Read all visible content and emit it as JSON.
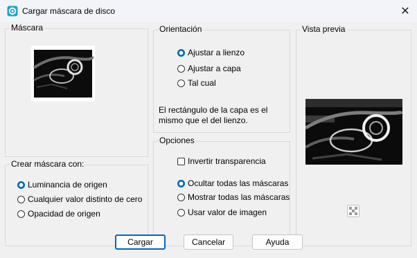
{
  "window": {
    "title": "Cargar máscara de disco",
    "close_glyph": "✕"
  },
  "mascara": {
    "label": "Máscara"
  },
  "crear": {
    "label": "Crear máscara con:",
    "options": [
      {
        "label": "Luminancia de origen",
        "selected": true
      },
      {
        "label": "Cualquier valor distinto de cero",
        "selected": false
      },
      {
        "label": "Opacidad de origen",
        "selected": false
      }
    ]
  },
  "orientacion": {
    "label": "Orientación",
    "options": [
      {
        "label": "Ajustar a lienzo",
        "selected": true
      },
      {
        "label": "Ajustar a capa",
        "selected": false
      },
      {
        "label": "Tal cual",
        "selected": false
      }
    ],
    "description": "El rectángulo de la capa es el mismo que el del lienzo."
  },
  "opciones": {
    "label": "Opciones",
    "invertir": "Invertir transparencia",
    "invertir_checked": false,
    "radios": [
      {
        "label": "Ocultar todas las máscaras",
        "selected": true
      },
      {
        "label": "Mostrar todas las máscaras",
        "selected": false
      },
      {
        "label": "Usar valor de imagen",
        "selected": false
      }
    ]
  },
  "vista_previa": {
    "label": "Vista previa"
  },
  "buttons": {
    "cargar": "Cargar",
    "cancelar": "Cancelar",
    "ayuda": "Ayuda"
  },
  "colors": {
    "accent": "#0067c0",
    "client_bg": "#f0f0f0"
  }
}
